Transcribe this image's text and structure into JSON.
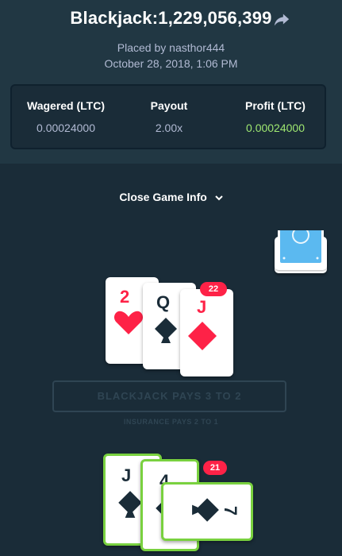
{
  "header": {
    "title": "Blackjack:1,229,056,399",
    "placed_by": "Placed by nasthor444",
    "date": "October 28, 2018, 1:06 PM"
  },
  "stats": {
    "wagered_label": "Wagered (LTC)",
    "wagered_value": "0.00024000",
    "payout_label": "Payout",
    "payout_value": "2.00x",
    "profit_label": "Profit (LTC)",
    "profit_value": "0.00024000"
  },
  "close_label": "Close Game Info",
  "dealer": {
    "total": "22",
    "cards": [
      {
        "rank": "2",
        "suit": "hearts"
      },
      {
        "rank": "Q",
        "suit": "spades"
      },
      {
        "rank": "J",
        "suit": "diamonds"
      }
    ]
  },
  "table": {
    "pays_text": "BLACKJACK PAYS 3 TO 2",
    "insurance_text": "INSURANCE PAYS 2 TO 1"
  },
  "player": {
    "total": "21",
    "cards": [
      {
        "rank": "J",
        "suit": "spades"
      },
      {
        "rank": "4",
        "suit": "spades"
      },
      {
        "rank": "7",
        "suit": "spades"
      }
    ]
  },
  "colors": {
    "header_bg": "#213743",
    "page_bg": "#1a2c38",
    "profit_green": "#9fe871",
    "win_border": "#79d13f",
    "badge_red": "#fe2247",
    "deck_blue": "#5bb9f0"
  },
  "icons": [
    "share-arrow-icon",
    "chevron-down-icon",
    "hearts-icon",
    "spades-icon",
    "diamonds-icon"
  ]
}
